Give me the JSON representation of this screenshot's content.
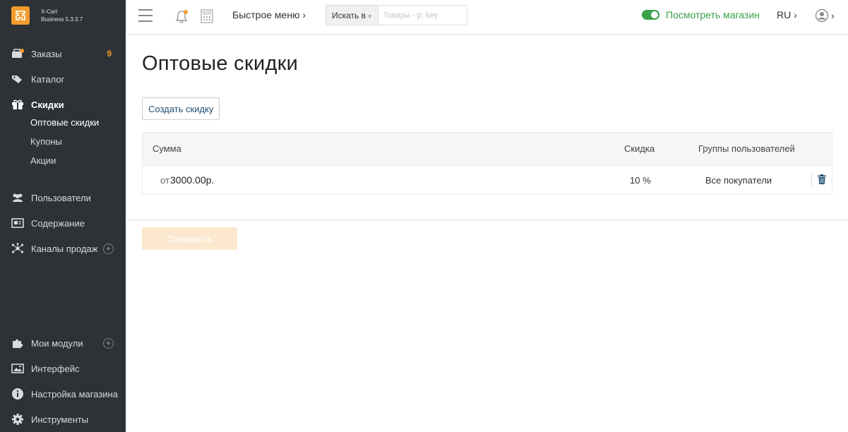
{
  "brand": {
    "logo_glyph": "X",
    "name": "X-Cart",
    "edition": "Business 5.3.3.7",
    "accent": "#f39c2d"
  },
  "sidebar": {
    "items": [
      {
        "label": "Заказы",
        "badge": "9",
        "icon": "orders-icon"
      },
      {
        "label": "Каталог",
        "icon": "tag-icon"
      },
      {
        "label": "Скидки",
        "icon": "gift-icon",
        "active": true
      },
      {
        "label": "Пользователи",
        "icon": "users-icon"
      },
      {
        "label": "Содержание",
        "icon": "content-icon"
      },
      {
        "label": "Каналы продаж",
        "icon": "sales-channels-icon"
      },
      {
        "label": "Мои модули",
        "icon": "puzzle-icon"
      },
      {
        "label": "Интерфейс",
        "icon": "image-icon"
      },
      {
        "label": "Настройка магазина",
        "icon": "info-icon"
      },
      {
        "label": "Инструменты",
        "icon": "gear-icon"
      }
    ],
    "sub_items": [
      {
        "label": "Оптовые скидки",
        "current": true
      },
      {
        "label": "Купоны"
      },
      {
        "label": "Акции"
      }
    ]
  },
  "topbar": {
    "quick_menu": "Быстрое меню ›",
    "search_in": "Искать в",
    "search_placeholder": "Товары - p: key",
    "view_store": "Посмотреть магазин",
    "lang": "RU ›",
    "user_caret": "›",
    "store_color": "#3aa14a"
  },
  "main": {
    "title": "Оптовые скидки",
    "create_button": "Создать скидку",
    "table": {
      "headers": {
        "sum": "Сумма",
        "discount": "Скидка",
        "groups": "Группы пользователей"
      },
      "rows": [
        {
          "from": "от",
          "sum": "3000.00р.",
          "discount": "10 %",
          "groups": "Все покупатели"
        }
      ]
    },
    "save_button": "Сохранить"
  }
}
